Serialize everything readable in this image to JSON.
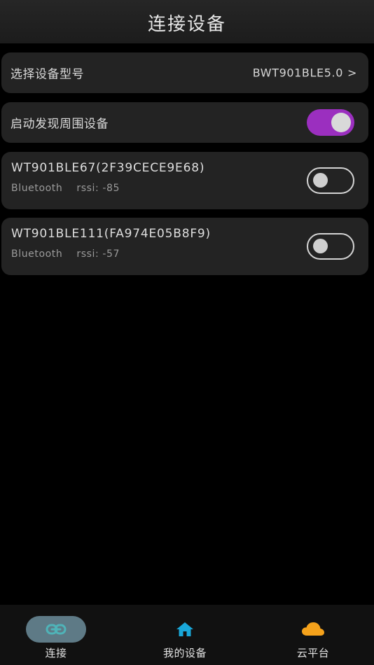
{
  "header": {
    "title": "连接设备"
  },
  "model_row": {
    "label": "选择设备型号",
    "value": "BWT901BLE5.0",
    "chevron": ">"
  },
  "scan_row": {
    "label": "启动发现周围设备",
    "enabled": true
  },
  "devices": [
    {
      "name": "WT901BLE67(2F39CECE9E68)",
      "type": "Bluetooth",
      "rssi": "rssi: -85",
      "connected": false
    },
    {
      "name": "WT901BLE111(FA974E05B8F9)",
      "type": "Bluetooth",
      "rssi": "rssi: -57",
      "connected": false
    }
  ],
  "nav": [
    {
      "label": "连接",
      "icon": "link-icon",
      "active": true
    },
    {
      "label": "我的设备",
      "icon": "home-icon",
      "active": false
    },
    {
      "label": "云平台",
      "icon": "cloud-icon",
      "active": false
    }
  ],
  "colors": {
    "background": "#000000",
    "card": "#232323",
    "toggle_on": "#9b2fbf",
    "nav_active_pill": "#5e7a86",
    "link_icon": "#4fb3b8",
    "home_icon": "#19a7d9",
    "cloud_icon": "#f5a21b"
  }
}
